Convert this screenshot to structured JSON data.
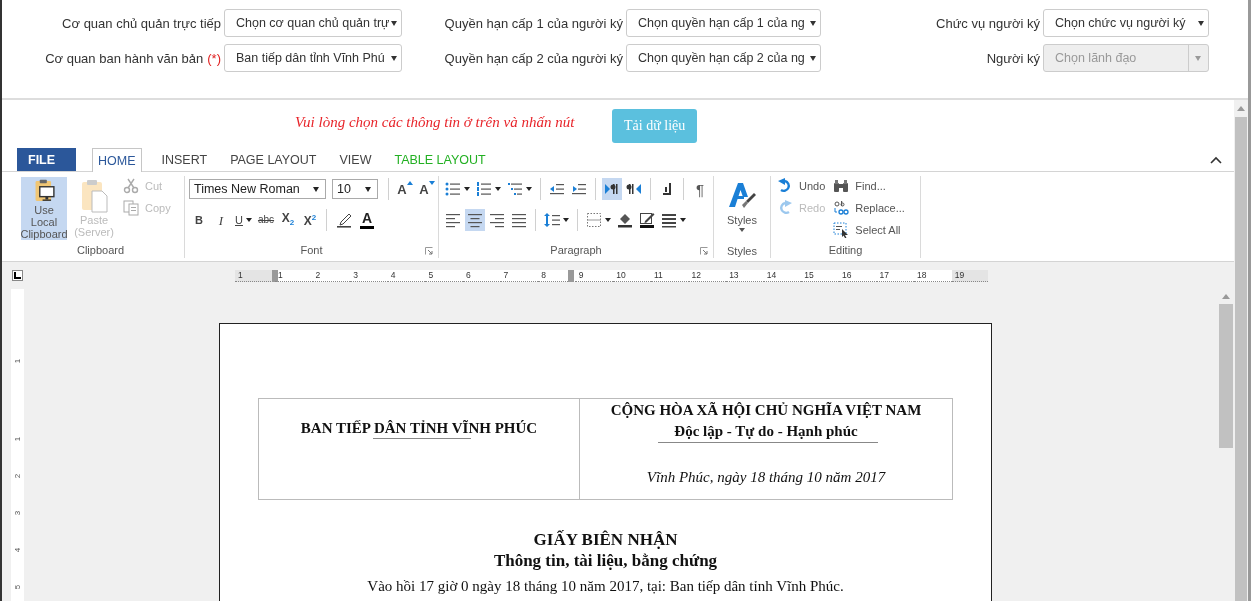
{
  "form": {
    "rows": [
      [
        {
          "label": "Cơ quan chủ quản trực tiếp",
          "value": "Chọn cơ quan chủ quản trự",
          "disabled": false
        },
        {
          "label": "Quyền hạn cấp 1 của người ký",
          "value": "Chọn quyền hạn cấp 1 của ng",
          "disabled": false
        },
        {
          "label": "Chức vụ người ký",
          "value": "Chọn chức vụ người ký",
          "disabled": false
        }
      ],
      [
        {
          "label": "Cơ quan ban hành văn bản",
          "required_mark": "(*)",
          "value": "Ban tiếp dân tỉnh Vĩnh Phú",
          "disabled": false
        },
        {
          "label": "Quyền hạn cấp 2 của người ký",
          "value": "Chọn quyền hạn cấp 2 của ng",
          "disabled": false
        },
        {
          "label": "Người ký",
          "value": "Chọn lãnh đạo",
          "disabled": true
        }
      ]
    ]
  },
  "notice": {
    "text": "Vui lòng chọn các thông tin ở trên và nhấn nút",
    "button": "Tải dữ liệu"
  },
  "ribbon": {
    "tabs": [
      {
        "label": "FILE",
        "kind": "file",
        "selected": false
      },
      {
        "label": "HOME",
        "kind": "main",
        "selected": true
      },
      {
        "label": "INSERT",
        "kind": "main",
        "selected": false
      },
      {
        "label": "PAGE LAYOUT",
        "kind": "main",
        "selected": false
      },
      {
        "label": "VIEW",
        "kind": "main",
        "selected": false
      },
      {
        "label": "TABLE LAYOUT",
        "kind": "contextual",
        "selected": false
      }
    ],
    "groups": [
      {
        "title": "Clipboard",
        "kind": "stack",
        "launcher": false,
        "columns": [
          [
            {
              "kind": "large",
              "label": "Use Local Clipboard",
              "selected": true,
              "disabled": false
            }
          ],
          [
            {
              "kind": "large",
              "label": "Paste (Server)",
              "selected": false,
              "disabled": true
            }
          ],
          [
            {
              "kind": "small",
              "label": "Cut",
              "disabled": true
            },
            {
              "kind": "small",
              "label": "Copy",
              "disabled": true
            }
          ]
        ]
      },
      {
        "title": "Font",
        "kind": "toolbar",
        "launcher": true,
        "top_row": [
          {
            "kind": "select",
            "value": "Times New Roman"
          },
          {
            "kind": "select",
            "value": "10"
          },
          {
            "kind": "tool",
            "text": "A",
            "selected": false
          },
          {
            "kind": "tool",
            "text": "A",
            "selected": false
          }
        ],
        "bottom_row": [
          {
            "kind": "tool",
            "text": "B",
            "selected": false
          },
          {
            "kind": "tool",
            "text": "I",
            "selected": false
          },
          {
            "kind": "tool",
            "text": "U",
            "caret": true,
            "selected": false
          },
          {
            "kind": "tool",
            "text": "abc",
            "selected": false
          },
          {
            "kind": "tool",
            "text": "X$_{2}$",
            "selected": false
          },
          {
            "kind": "tool",
            "text": "X$^{2}$",
            "selected": false
          },
          {
            "kind": "tool",
            "selected": false
          },
          {
            "kind": "tool",
            "text": "A",
            "selected": false
          }
        ]
      },
      {
        "title": "Paragraph",
        "kind": "toolbar",
        "launcher": true,
        "top_row": [
          {
            "kind": "tool",
            "caret": true,
            "selected": false
          },
          {
            "kind": "tool",
            "caret": true,
            "selected": false
          },
          {
            "kind": "tool",
            "caret": true,
            "selected": false
          },
          {
            "kind": "tool",
            "selected": false
          },
          {
            "kind": "tool",
            "selected": false
          },
          {
            "kind": "tool",
            "selected": true
          },
          {
            "kind": "tool",
            "selected": false
          },
          {
            "kind": "tool",
            "selected": false
          },
          {
            "kind": "tool",
            "text": "¶",
            "selected": false
          }
        ],
        "bottom_row": [
          {
            "kind": "tool",
            "selected": false
          },
          {
            "kind": "tool",
            "selected": true
          },
          {
            "kind": "tool",
            "selected": false
          },
          {
            "kind": "tool",
            "selected": false
          },
          {
            "kind": "tool",
            "caret": true,
            "selected": false
          },
          {
            "kind": "tool",
            "caret": true,
            "selected": false
          },
          {
            "kind": "tool",
            "selected": false
          },
          {
            "kind": "tool",
            "selected": false
          },
          {
            "kind": "tool",
            "caret": true,
            "selected": false
          }
        ]
      },
      {
        "title": "Styles",
        "kind": "stack",
        "launcher": false,
        "columns": [
          [
            {
              "kind": "large",
              "label": "Styles",
              "caret": true,
              "selected": false,
              "disabled": false
            }
          ]
        ]
      },
      {
        "title": "Editing",
        "kind": "stack",
        "launcher": false,
        "columns": [
          [
            {
              "kind": "small",
              "label": "Undo",
              "disabled": false
            },
            {
              "kind": "small",
              "label": "Redo",
              "disabled": true
            }
          ],
          [
            {
              "kind": "small",
              "label": "Find...",
              "disabled": false
            },
            {
              "kind": "small",
              "label": "Replace...",
              "disabled": false
            },
            {
              "kind": "small",
              "label": "Select All",
              "disabled": false
            }
          ]
        ]
      }
    ]
  },
  "ruler": {
    "labels": [
      "1",
      "1",
      "2",
      "3",
      "4",
      "5",
      "6",
      "7",
      "8",
      "9",
      "10",
      "11",
      "12",
      "13",
      "14",
      "15",
      "16",
      "17",
      "18",
      "19"
    ]
  },
  "vertical_ruler": {
    "labels": [
      "1",
      "1",
      "2",
      "3",
      "4",
      "5"
    ]
  },
  "document": {
    "header_left": "BAN TIẾP DÂN TỈNH VĨNH PHÚC",
    "header_right": [
      "CỘNG HÒA XÃ HỘI CHỦ NGHĨA VIỆT NAM",
      "Độc lập - Tự do - Hạnh phúc"
    ],
    "place_date": "Vĩnh Phúc, ngày 18 tháng 10 năm 2017",
    "title": "GIẤY BIÊN NHẬN",
    "subtitle": "Thông tin, tài liệu, bằng chứng",
    "body": [
      "Vào hồi 17 giờ 0 ngày 18 tháng 10 năm 2017, tại: Ban tiếp dân tỉnh Vĩnh Phúc."
    ]
  }
}
